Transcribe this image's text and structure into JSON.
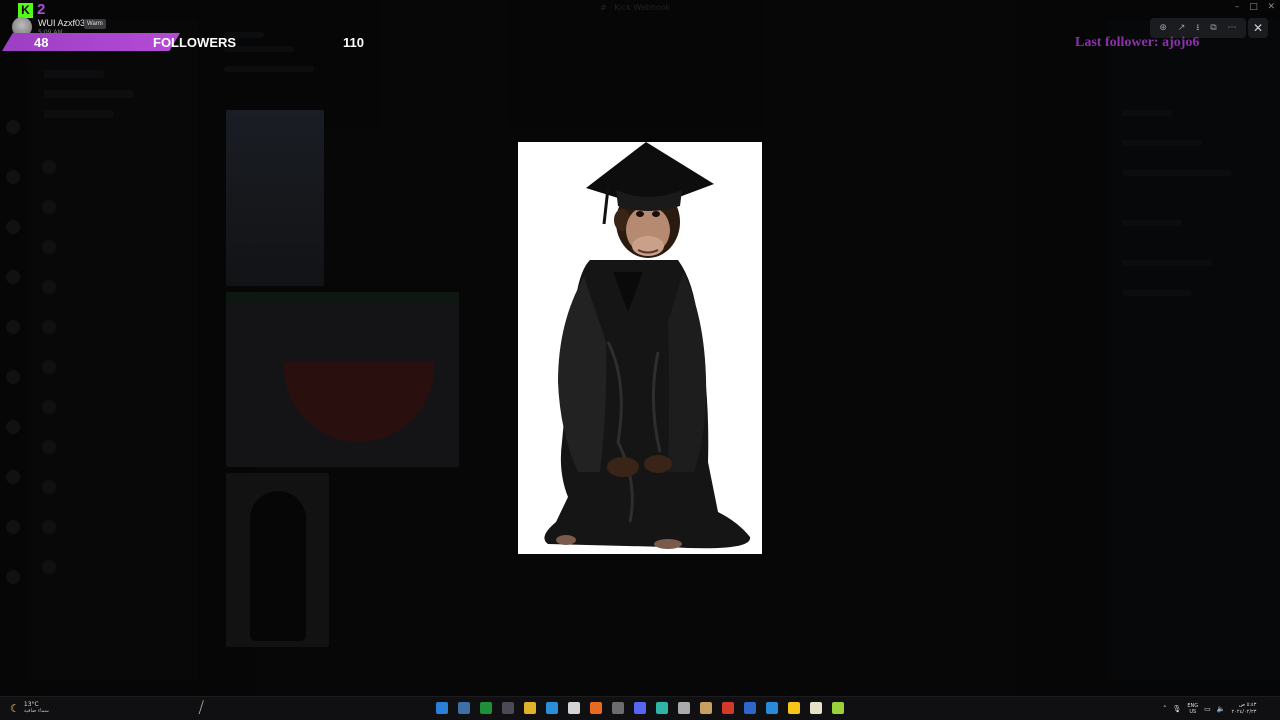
{
  "window": {
    "title": "# · Kick Webhook"
  },
  "overlay": {
    "kick_count": "2",
    "user_name": "WUI Azxf03",
    "user_badge": "Warm",
    "user_sub": "5:09 AM",
    "followers_count": "48",
    "followers_label": "FOLLOWERS",
    "followers_goal": "110",
    "last_follower": "Last follower: ajojo6"
  },
  "viewer": {
    "toolbar_icons": [
      "zoom-icon",
      "share-icon",
      "download-icon",
      "open-external-icon",
      "more-icon"
    ],
    "close_label": "✕"
  },
  "taskbar": {
    "weather_temp": "13°C",
    "weather_desc": "سماء صافية",
    "lang_top": "ENG",
    "lang_bottom": "US",
    "clock_time": "٥:٤٣ ص",
    "clock_date": "٢٠٢٤/٠٢/٢٣"
  },
  "colors": {
    "kick_green": "#53fc18",
    "accent_purple": "#b14bd8",
    "last_follower_purple": "#8e2fae"
  }
}
